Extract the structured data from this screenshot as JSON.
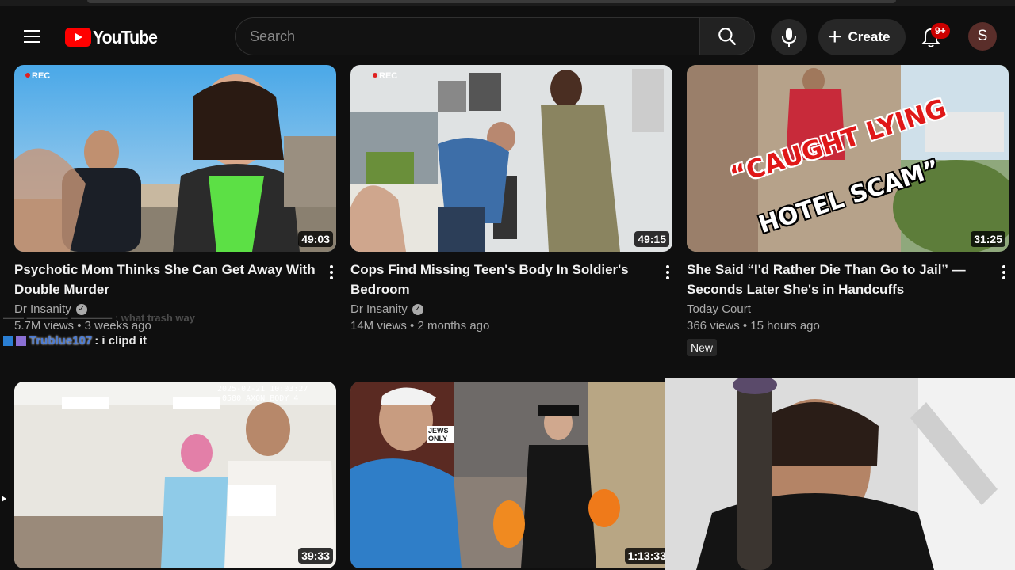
{
  "masthead": {
    "logo_text": "YouTube",
    "search_placeholder": "Search",
    "create_label": "Create",
    "notification_count": "9+",
    "avatar_letter": "S"
  },
  "videos": [
    {
      "title": "Psychotic Mom Thinks She Can Get Away With Double Murder",
      "channel": "Dr Insanity",
      "verified": true,
      "views": "5.7M views",
      "age": "3 weeks ago",
      "duration": "49:03",
      "thumb_overlay": "REC"
    },
    {
      "title": "Cops Find Missing Teen's Body In Soldier's Bedroom",
      "channel": "Dr Insanity",
      "verified": true,
      "views": "14M views",
      "age": "2 months ago",
      "duration": "49:15",
      "thumb_overlay": "REC"
    },
    {
      "title": "She Said “I'd Rather Die Than Go to Jail” — Seconds Later She's in Handcuffs",
      "channel": "Today Court",
      "verified": false,
      "views": "366 views",
      "age": "15 hours ago",
      "duration": "31:25",
      "badge": "New",
      "thumb_text_1": "“CAUGHT LYING",
      "thumb_text_2": "HOTEL SCAM”"
    },
    {
      "duration": "39:33",
      "thumb_overlay": "2025-02-21 10:03:27 -0500 AXON BODY 4"
    },
    {
      "duration": "1:13:33",
      "thumb_overlay": "JEWS ONLY"
    },
    {
      "duration": ""
    }
  ],
  "chat": {
    "faded_line": "—— ———— ———— : what trash way",
    "user": "Trublue107",
    "message": ": i clipd it"
  },
  "colors": {
    "background": "#0f0f0f",
    "accent": "#ff0000",
    "badge": "#cc0000",
    "secondary_text": "#aaaaaa"
  }
}
